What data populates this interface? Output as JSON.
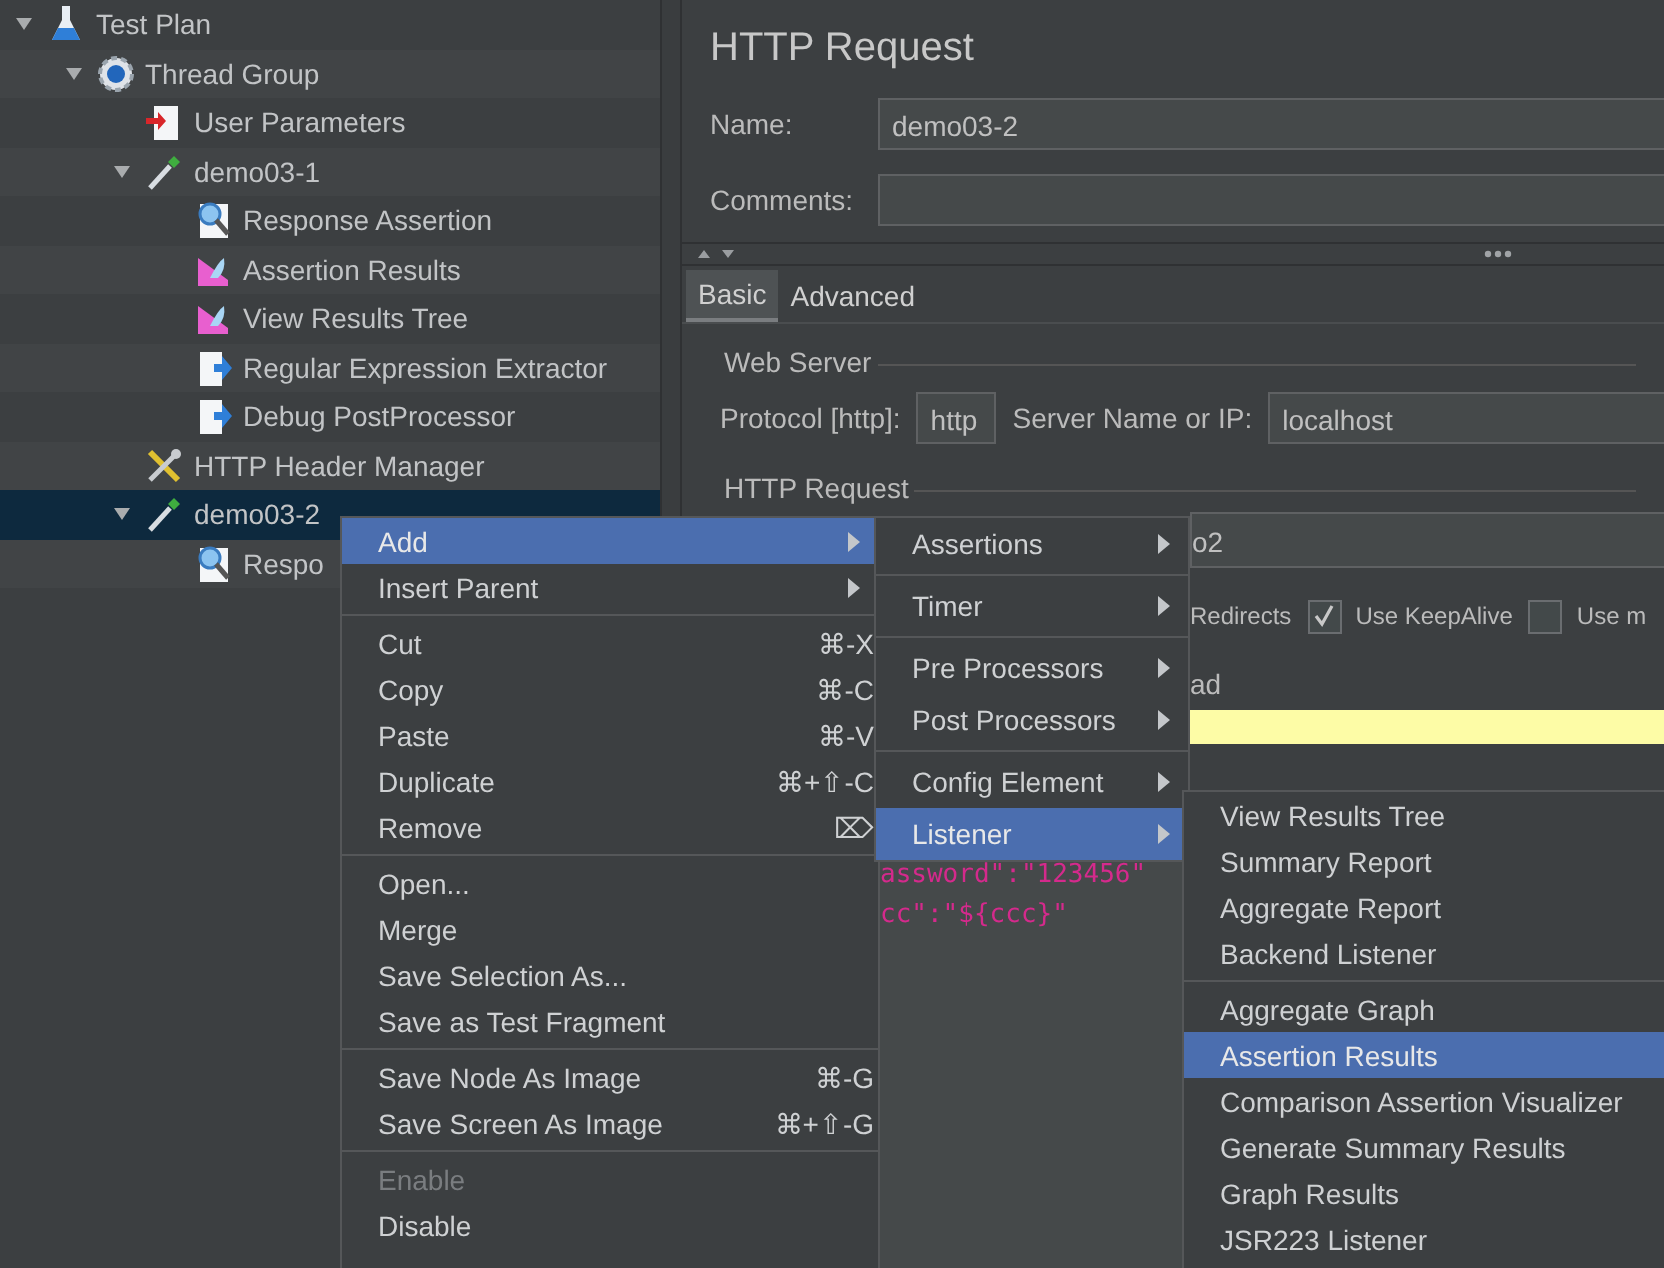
{
  "tree": [
    {
      "label": "Test Plan",
      "kind": "test_plan",
      "expanded": true,
      "selected": false,
      "children": [
        {
          "label": "Thread Group",
          "kind": "thread_group",
          "expanded": true,
          "selected": false,
          "children": [
            {
              "label": "User Parameters",
              "kind": "pre_processor",
              "selected": false
            },
            {
              "label": "demo03-1",
              "kind": "sampler",
              "expanded": true,
              "selected": false,
              "children": [
                {
                  "label": "Response Assertion",
                  "kind": "assertion",
                  "selected": false
                },
                {
                  "label": "Assertion Results",
                  "kind": "listener",
                  "selected": false
                },
                {
                  "label": "View Results Tree",
                  "kind": "listener",
                  "selected": false
                },
                {
                  "label": "Regular Expression Extractor",
                  "kind": "post_processor",
                  "selected": false
                },
                {
                  "label": "Debug PostProcessor",
                  "kind": "post_processor",
                  "selected": false
                }
              ]
            },
            {
              "label": "HTTP Header Manager",
              "kind": "config_element",
              "selected": false
            },
            {
              "label": "demo03-2",
              "kind": "sampler",
              "expanded": true,
              "selected": true,
              "children": [
                {
                  "label": "Respo",
                  "kind": "assertion",
                  "selected": false
                }
              ]
            }
          ]
        }
      ]
    }
  ],
  "panel": {
    "title": "HTTP Request",
    "name": {
      "label": "Name:",
      "value": "demo03-2"
    },
    "comments": {
      "label": "Comments:"
    },
    "tabs": [
      {
        "label": "Basic",
        "selected": true
      },
      {
        "label": "Advanced",
        "selected": false
      }
    ],
    "web_server": {
      "legend": "Web Server",
      "protocol_label": "Protocol [http]:",
      "protocol_value": "http",
      "server_label": "Server Name or IP:",
      "server_value": "localhost"
    },
    "http_request": {
      "legend": "HTTP Request",
      "path_value": "o2",
      "redirects_label": "Redirects",
      "checkboxes": [
        {
          "label": "Use KeepAlive",
          "checked": true
        },
        {
          "label": "Use m",
          "checked": false
        }
      ],
      "body_tab": "ad",
      "code_lines": [
        "assword\":\"123456\"",
        "cc\":\"${ccc}\""
      ]
    }
  },
  "context_menu": {
    "groups": [
      [
        {
          "label": "Add",
          "submenu": true,
          "selected": true,
          "disabled": false
        },
        {
          "label": "Insert Parent",
          "submenu": true,
          "selected": false,
          "disabled": false
        }
      ],
      [
        {
          "label": "Cut",
          "shortcut": "⌘-X",
          "submenu": false,
          "selected": false,
          "disabled": false
        },
        {
          "label": "Copy",
          "shortcut": "⌘-C",
          "submenu": false,
          "selected": false,
          "disabled": false
        },
        {
          "label": "Paste",
          "shortcut": "⌘-V",
          "submenu": false,
          "selected": false,
          "disabled": false
        },
        {
          "label": "Duplicate",
          "shortcut": "⌘+⇧-C",
          "submenu": false,
          "selected": false,
          "disabled": false
        },
        {
          "label": "Remove",
          "shortcut": "⌦",
          "submenu": false,
          "selected": false,
          "disabled": false
        }
      ],
      [
        {
          "label": "Open...",
          "submenu": false,
          "selected": false,
          "disabled": false
        },
        {
          "label": "Merge",
          "submenu": false,
          "selected": false,
          "disabled": false
        },
        {
          "label": "Save Selection As...",
          "submenu": false,
          "selected": false,
          "disabled": false
        },
        {
          "label": "Save as Test Fragment",
          "submenu": false,
          "selected": false,
          "disabled": false
        }
      ],
      [
        {
          "label": "Save Node As Image",
          "shortcut": "⌘-G",
          "submenu": false,
          "selected": false,
          "disabled": false
        },
        {
          "label": "Save Screen As Image",
          "shortcut": "⌘+⇧-G",
          "submenu": false,
          "selected": false,
          "disabled": false
        }
      ],
      [
        {
          "label": "Enable",
          "submenu": false,
          "selected": false,
          "disabled": true
        },
        {
          "label": "Disable",
          "submenu": false,
          "selected": false,
          "disabled": false
        }
      ]
    ]
  },
  "add_menu": {
    "groups": [
      [
        {
          "label": "Assertions",
          "submenu": true,
          "selected": false
        }
      ],
      [
        {
          "label": "Timer",
          "submenu": true,
          "selected": false
        }
      ],
      [
        {
          "label": "Pre Processors",
          "submenu": true,
          "selected": false
        },
        {
          "label": "Post Processors",
          "submenu": true,
          "selected": false
        }
      ],
      [
        {
          "label": "Config Element",
          "submenu": true,
          "selected": false
        },
        {
          "label": "Listener",
          "submenu": true,
          "selected": true
        }
      ]
    ]
  },
  "listener_menu": {
    "groups": [
      [
        {
          "label": "View Results Tree",
          "selected": false
        },
        {
          "label": "Summary Report",
          "selected": false
        },
        {
          "label": "Aggregate Report",
          "selected": false
        },
        {
          "label": "Backend Listener",
          "selected": false
        }
      ],
      [
        {
          "label": "Aggregate Graph",
          "selected": false
        },
        {
          "label": "Assertion Results",
          "selected": true
        },
        {
          "label": "Comparison Assertion Visualizer",
          "selected": false
        },
        {
          "label": "Generate Summary Results",
          "selected": false
        },
        {
          "label": "Graph Results",
          "selected": false
        },
        {
          "label": "JSR223 Listener",
          "selected": false
        }
      ]
    ]
  }
}
